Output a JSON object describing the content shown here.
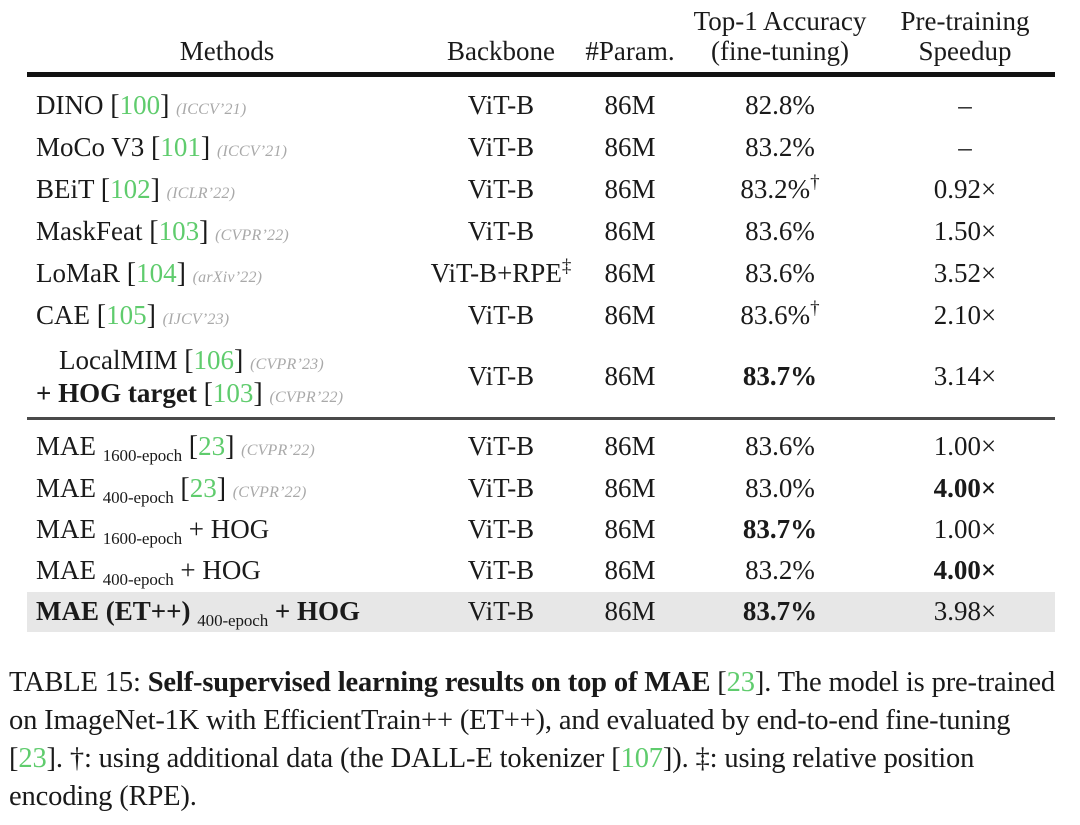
{
  "table": {
    "number": "TABLE 15",
    "columns": [
      {
        "id": "methods",
        "label": "Methods",
        "label2": ""
      },
      {
        "id": "backbone",
        "label": "Backbone",
        "label2": ""
      },
      {
        "id": "param",
        "label": "#Param.",
        "label2": ""
      },
      {
        "id": "accuracy",
        "label": "Top-1 Accuracy",
        "label2": "(fine-tuning)"
      },
      {
        "id": "speedup",
        "label": "Pre-training",
        "label2": "Speedup"
      }
    ],
    "group1": [
      {
        "method": "DINO",
        "ref": "100",
        "venue": "(ICCV’21)",
        "backbone": "ViT-B",
        "param": "86M",
        "accuracy": "82.8%",
        "accuracy_dagger": "",
        "accuracy_bold": false,
        "speedup": "–",
        "speedup_bold": false
      },
      {
        "method": "MoCo V3",
        "ref": "101",
        "venue": "(ICCV’21)",
        "backbone": "ViT-B",
        "param": "86M",
        "accuracy": "83.2%",
        "accuracy_dagger": "",
        "accuracy_bold": false,
        "speedup": "–",
        "speedup_bold": false
      },
      {
        "method": "BEiT",
        "ref": "102",
        "venue": "(ICLR’22)",
        "backbone": "ViT-B",
        "param": "86M",
        "accuracy": "83.2%",
        "accuracy_dagger": "†",
        "accuracy_bold": false,
        "speedup": "0.92×",
        "speedup_bold": false
      },
      {
        "method": "MaskFeat",
        "ref": "103",
        "venue": "(CVPR’22)",
        "backbone": "ViT-B",
        "param": "86M",
        "accuracy": "83.6%",
        "accuracy_dagger": "",
        "accuracy_bold": false,
        "speedup": "1.50×",
        "speedup_bold": false
      },
      {
        "method": "LoMaR",
        "ref": "104",
        "venue": "(arXiv’22)",
        "backbone": "ViT-B+RPE",
        "backbone_dagger": "‡",
        "param": "86M",
        "accuracy": "83.6%",
        "accuracy_dagger": "",
        "accuracy_bold": false,
        "speedup": "3.52×",
        "speedup_bold": false
      },
      {
        "method": "CAE",
        "ref": "105",
        "venue": "(IJCV’23)",
        "backbone": "ViT-B",
        "param": "86M",
        "accuracy": "83.6%",
        "accuracy_dagger": "†",
        "accuracy_bold": false,
        "speedup": "2.10×",
        "speedup_bold": false
      }
    ],
    "localmim": {
      "line1_method": "LocalMIM",
      "line1_ref": "106",
      "line1_venue": "(CVPR’23)",
      "line2_method": "+ HOG target",
      "line2_ref": "103",
      "line2_venue": "(CVPR’22)",
      "backbone": "ViT-B",
      "param": "86M",
      "accuracy": "83.7%",
      "accuracy_bold": true,
      "speedup": "3.14×",
      "speedup_bold": false
    },
    "group2": [
      {
        "method": "MAE",
        "sub": "1600-epoch",
        "suffix": "",
        "ref": "23",
        "venue": "(CVPR’22)",
        "method_bold": false,
        "backbone": "ViT-B",
        "param": "86M",
        "accuracy": "83.6%",
        "accuracy_bold": false,
        "speedup": "1.00×",
        "speedup_bold": false,
        "highlight": false
      },
      {
        "method": "MAE",
        "sub": "400-epoch",
        "suffix": "",
        "ref": "23",
        "venue": "(CVPR’22)",
        "method_bold": false,
        "backbone": "ViT-B",
        "param": "86M",
        "accuracy": "83.0%",
        "accuracy_bold": false,
        "speedup": "4.00×",
        "speedup_bold": true,
        "highlight": false
      },
      {
        "method": "MAE",
        "sub": "1600-epoch",
        "suffix": "+ HOG",
        "ref": "",
        "venue": "",
        "method_bold": false,
        "backbone": "ViT-B",
        "param": "86M",
        "accuracy": "83.7%",
        "accuracy_bold": true,
        "speedup": "1.00×",
        "speedup_bold": false,
        "highlight": false
      },
      {
        "method": "MAE",
        "sub": "400-epoch",
        "suffix": "+ HOG",
        "ref": "",
        "venue": "",
        "method_bold": false,
        "backbone": "ViT-B",
        "param": "86M",
        "accuracy": "83.2%",
        "accuracy_bold": false,
        "speedup": "4.00×",
        "speedup_bold": true,
        "highlight": false
      },
      {
        "method": "MAE (ET++)",
        "sub": "400-epoch",
        "suffix": "+ HOG",
        "ref": "",
        "venue": "",
        "method_bold": true,
        "backbone": "ViT-B",
        "param": "86M",
        "accuracy": "83.7%",
        "accuracy_bold": true,
        "speedup": "3.98×",
        "speedup_bold": false,
        "highlight": true
      }
    ]
  },
  "caption": {
    "label": "TABLE 15: ",
    "bold_part": "Self-supervised learning results on top of MAE",
    "ref1": "23",
    "rest1": ". The model is pre-trained on ImageNet-1K with EfficientTrain++ (ET++), and evaluated by end-to-end fine-tuning [",
    "ref2": "23",
    "rest2": "]. †: using additional data (the DALL-E tokenizer [",
    "ref3": "107",
    "rest3": "]). ‡: using relative position encoding (RPE)."
  },
  "colors": {
    "reference_green": "#5fcc6d",
    "venue_gray": "#a9a9a9",
    "highlight_row": "#e7e7e7",
    "text": "#1a1a1a"
  }
}
